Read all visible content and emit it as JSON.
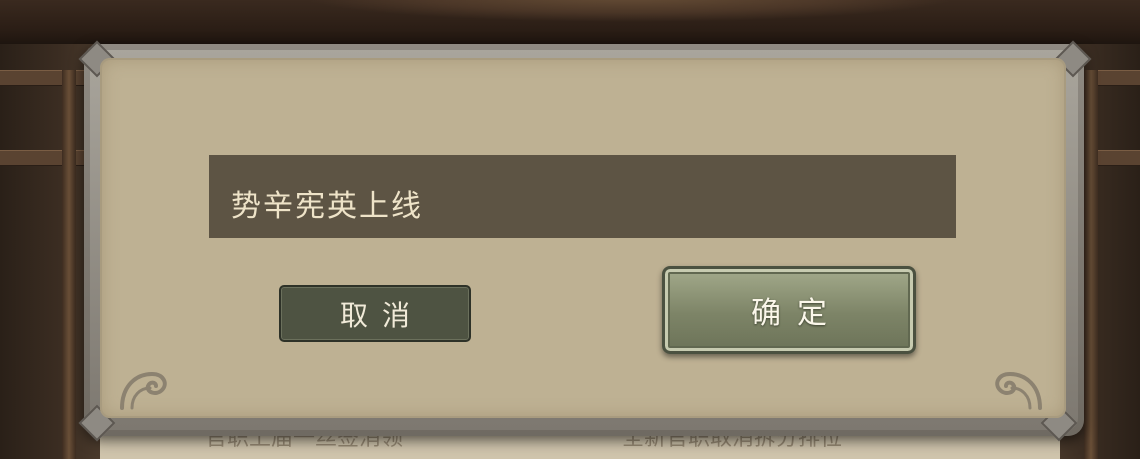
{
  "dialog": {
    "message": "势辛宪英上线",
    "cancel_label": "取消",
    "confirm_label": "确定"
  },
  "background": {
    "left_text": "官职上届一丝签消领",
    "right_text": "全新官职取消拆分排位"
  },
  "colors": {
    "panel": "#beb193",
    "message_box": "#5d5444",
    "cancel_button": "#4e5342",
    "confirm_button": "#7d8467"
  }
}
